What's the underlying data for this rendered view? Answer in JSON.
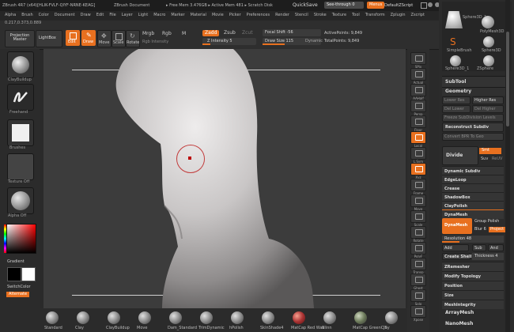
{
  "title": {
    "app": "ZBrush 4R7 (x64)[HLIK-FVLF-QIYF-NRNE-KEAG]",
    "doc": "ZBrush Document",
    "stats": "▸ Free Mem 3.476GB ▸ Active Mem 481 ▸ Scratch Disk",
    "quicksave": "QuickSave",
    "see_through": "See-through  0",
    "menus_btn": "Menus",
    "default_script": "DefaultZScript"
  },
  "menubar": [
    "Alpha",
    "Brush",
    "Color",
    "Document",
    "Draw",
    "Edit",
    "File",
    "Layer",
    "Light",
    "Macro",
    "Marker",
    "Material",
    "Movie",
    "Picker",
    "Preferences",
    "Render",
    "Stencil",
    "Stroke",
    "Texture",
    "Tool",
    "Transform",
    "Zplugin",
    "Zscript"
  ],
  "coords": "0.217,0.373,0.889",
  "toolbar": {
    "projection_master": "Projection Master",
    "lightbox": "LightBox",
    "edit": "Edit",
    "draw": "Draw",
    "move": "Move",
    "scale": "Scale",
    "rotate": "Rotate",
    "mrgb": "Mrgb",
    "rgb": "Rgb",
    "m": "M",
    "rgb_intensity": "Rgb Intensity",
    "zadd": "Zadd",
    "zsub": "Zsub",
    "zcut": "Zcut",
    "z_intensity": "Z Intensity 5",
    "focal_shift": "Focal Shift -56",
    "draw_size": "Draw Size 115",
    "dynamic": "Dynamic",
    "active_points": "ActivePoints: 9,849",
    "total_points": "TotalPoints: 9,849"
  },
  "leftshelf": {
    "items": [
      "ClayBuildup",
      "Freehand",
      "Brushes",
      "Texture Off",
      "Alpha Off"
    ],
    "gradient": "Gradient",
    "switch_color": "SwitchColor",
    "alternate": "Alternate"
  },
  "rightshelf": [
    "SPix",
    "Actual",
    "AAHalf",
    "Persp",
    "Floor",
    "Local",
    "L.Sym",
    "Xyz",
    "Frame",
    "Move",
    "Scale",
    "Rotate",
    "PolyF",
    "Transp",
    "Ghost",
    "Solo",
    "Xpose"
  ],
  "tray": {
    "tools": [
      "Sphere3D_1",
      "PolyMesh3D",
      "SimpleBrush",
      "Sphere3D",
      "Sphere3D_1",
      "ZSphere"
    ],
    "subtool": "SubTool",
    "geometry": "Geometry",
    "lower_res": "Lower Res",
    "higher_res": "Higher Res",
    "del_lower": "Del Lower",
    "del_higher": "Del Higher",
    "freeze": "Freeze SubDivision Levels",
    "reconstruct": "Reconstruct Subdiv",
    "convert_bpr": "Convert BPR To Geo",
    "divide": "Divide",
    "smt": "Smt",
    "suv": "Suv",
    "reuv": "ReUV",
    "rows": [
      "Dynamic Subdiv",
      "EdgeLoop",
      "Crease",
      "ShadowBox",
      "ClayPolish",
      "DynaMesh"
    ],
    "dynamesh_btn": "DynaMesh",
    "group_polish": "Group Polish",
    "blur": "Blur 6",
    "project": "Project",
    "resolution": "Resolution 48",
    "add": "Add",
    "sub": "Sub",
    "and": "And",
    "create_shell": "Create Shell",
    "thickness": "Thickness 4",
    "rows2": [
      "ZRemesher",
      "Modify Topology",
      "Position",
      "Size",
      "MeshIntegrity"
    ],
    "array_mesh": "ArrayMesh",
    "nano_mesh": "NanoMesh"
  },
  "bottomshelf": [
    "Standard",
    "Clay",
    "ClayBuildup",
    "Move",
    "Dam_Standard",
    "TrimDynamic",
    "hPolish",
    "SkinShade4",
    "MatCap Red Wax",
    "Blinn",
    "MatCap GreenClay",
    "JS"
  ],
  "colors": {
    "accent": "#e8701f",
    "viewport": "#3c3c3c",
    "panel": "#2b2b2b"
  }
}
